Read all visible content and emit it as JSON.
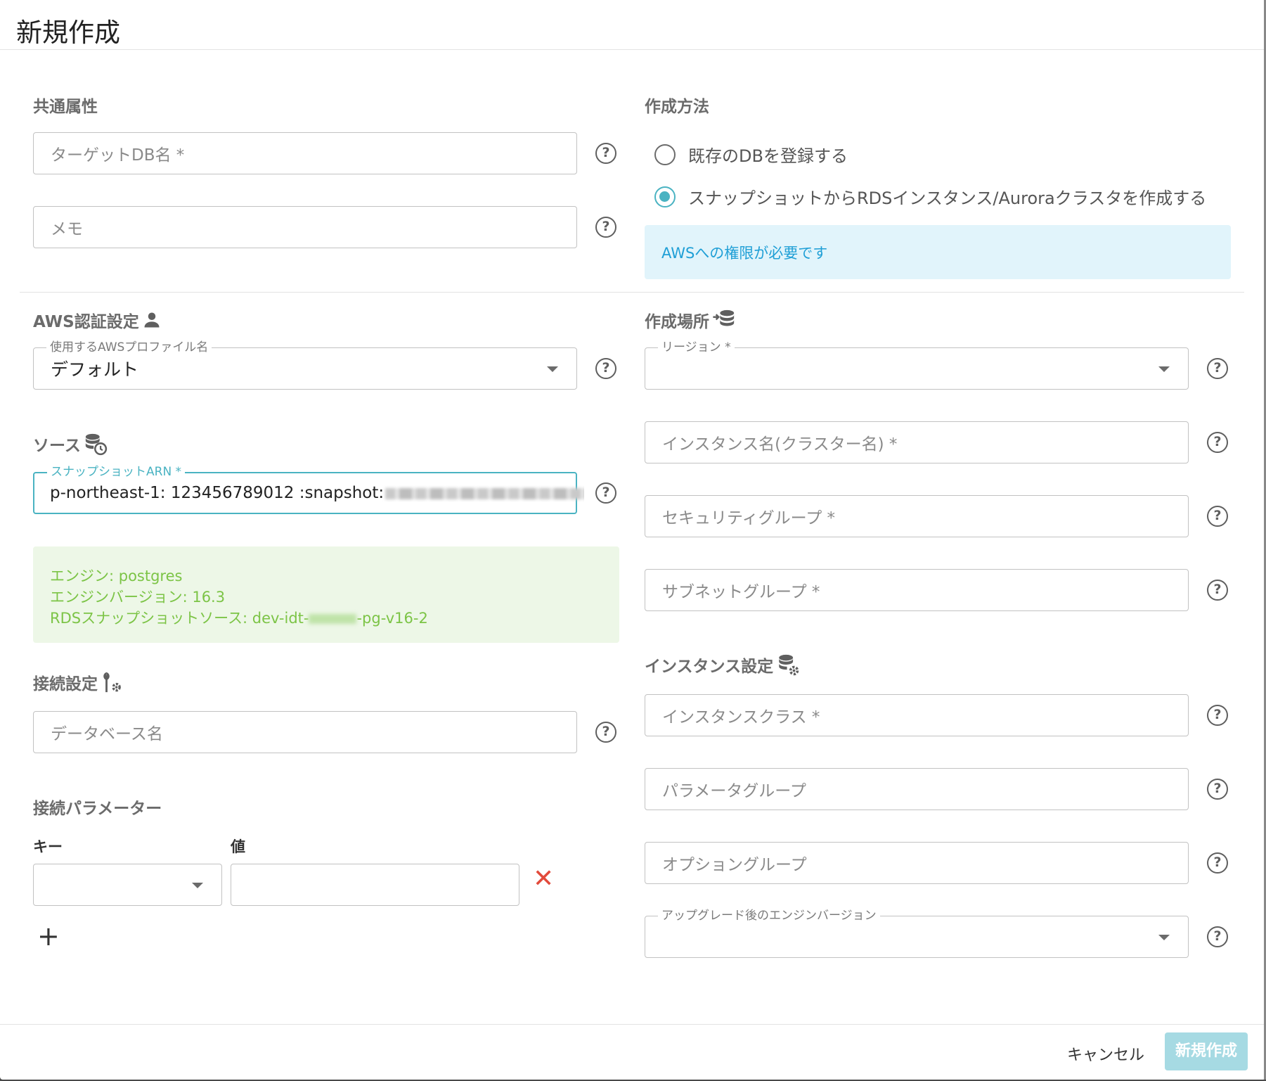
{
  "dialog": {
    "title": "新規作成"
  },
  "common": {
    "section_title": "共通属性",
    "target_db_placeholder": "ターゲットDB名 *",
    "memo_placeholder": "メモ"
  },
  "method": {
    "section_title": "作成方法",
    "option_existing": "既存のDBを登録する",
    "option_snapshot": "スナップショットからRDSインスタンス/Auroraクラスタを作成する",
    "selected": "option_snapshot",
    "info": "AWSへの権限が必要です"
  },
  "aws_auth": {
    "section_title": "AWS認証設定",
    "profile_label": "使用するAWSプロファイル名",
    "profile_value": "デフォルト"
  },
  "source": {
    "section_title": "ソース",
    "arn_label": "スナップショットARN *",
    "arn_value": "p-northeast-1: 123456789012 :snapshot:",
    "engine": "エンジン: postgres",
    "engine_version": "エンジンバージョン: 16.3",
    "snapshot_source_prefix": "RDSスナップショットソース: dev-idt-",
    "snapshot_source_suffix": "-pg-v16-2"
  },
  "connection": {
    "section_title": "接続設定",
    "database_placeholder": "データベース名",
    "params_title": "接続パラメーター",
    "key_label": "キー",
    "value_label": "値",
    "add_symbol": "+",
    "remove_symbol": "✕"
  },
  "location": {
    "section_title": "作成場所",
    "region_label": "リージョン *",
    "instance_name_placeholder": "インスタンス名(クラスター名) *",
    "security_group_placeholder": "セキュリティグループ *",
    "subnet_group_placeholder": "サブネットグループ *"
  },
  "instance": {
    "section_title": "インスタンス設定",
    "instance_class_placeholder": "インスタンスクラス *",
    "parameter_group_placeholder": "パラメータグループ",
    "option_group_placeholder": "オプショングループ",
    "upgrade_version_label": "アップグレード後のエンジンバージョン"
  },
  "footer": {
    "cancel_label": "キャンセル",
    "submit_label": "新規作成"
  },
  "help_symbol": "?",
  "colors": {
    "accent": "#4ab3c2",
    "info_text": "#1f9fd6",
    "info_bg": "#e1f4fb",
    "success_text": "#7cc446",
    "success_bg": "#edf7e7",
    "danger": "#e24a3b",
    "submit_disabled": "#a6dae3"
  }
}
